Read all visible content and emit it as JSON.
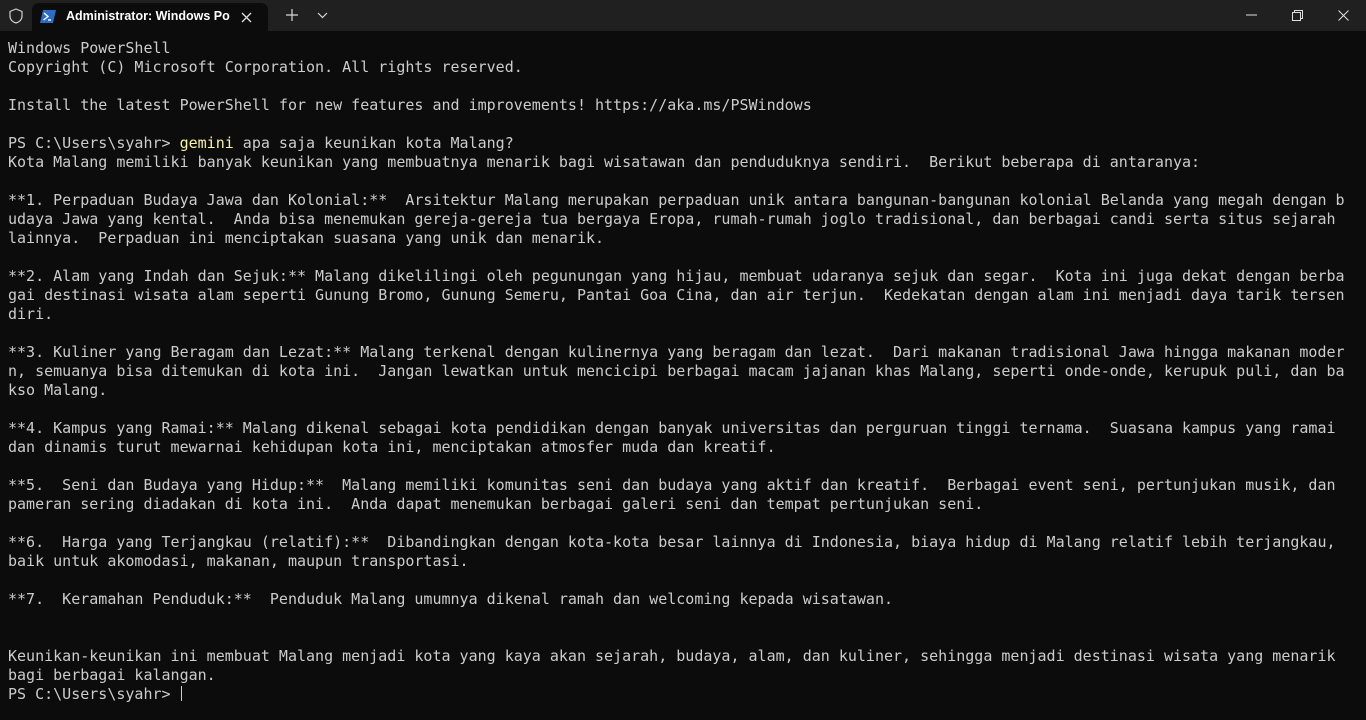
{
  "window": {
    "tab_title": "Administrator: Windows PowerShell",
    "icons": [
      "shield-icon",
      "powershell-icon",
      "close-icon",
      "plus-icon",
      "chevron-down-icon",
      "minimize-icon",
      "restore-icon",
      "window-close-icon"
    ],
    "colors": {
      "titlebar": "#202020",
      "terminal_bg": "#0c0c0c",
      "text": "#cccccc",
      "command": "#f9f1a5"
    }
  },
  "terminal": {
    "lines": [
      {
        "text": "Windows PowerShell"
      },
      {
        "text": "Copyright (C) Microsoft Corporation. All rights reserved."
      },
      {
        "text": ""
      },
      {
        "text": "Install the latest PowerShell for new features and improvements! https://aka.ms/PSWindows"
      },
      {
        "text": ""
      },
      {
        "prompt": "PS C:\\Users\\syahr> ",
        "command": "gemini",
        "args": " apa saja keunikan kota Malang?"
      },
      {
        "text": "Kota Malang memiliki banyak keunikan yang membuatnya menarik bagi wisatawan dan penduduknya sendiri.  Berikut beberapa di antaranya:"
      },
      {
        "text": ""
      },
      {
        "text": "**1. Perpaduan Budaya Jawa dan Kolonial:**  Arsitektur Malang merupakan perpaduan unik antara bangunan-bangunan kolonial Belanda yang megah dengan b"
      },
      {
        "text": "udaya Jawa yang kental.  Anda bisa menemukan gereja-gereja tua bergaya Eropa, rumah-rumah joglo tradisional, dan berbagai candi serta situs sejarah"
      },
      {
        "text": "lainnya.  Perpaduan ini menciptakan suasana yang unik dan menarik."
      },
      {
        "text": ""
      },
      {
        "text": "**2. Alam yang Indah dan Sejuk:** Malang dikelilingi oleh pegunungan yang hijau, membuat udaranya sejuk dan segar.  Kota ini juga dekat dengan berba"
      },
      {
        "text": "gai destinasi wisata alam seperti Gunung Bromo, Gunung Semeru, Pantai Goa Cina, dan air terjun.  Kedekatan dengan alam ini menjadi daya tarik tersen"
      },
      {
        "text": "diri."
      },
      {
        "text": ""
      },
      {
        "text": "**3. Kuliner yang Beragam dan Lezat:** Malang terkenal dengan kulinernya yang beragam dan lezat.  Dari makanan tradisional Jawa hingga makanan moder"
      },
      {
        "text": "n, semuanya bisa ditemukan di kota ini.  Jangan lewatkan untuk mencicipi berbagai macam jajanan khas Malang, seperti onde-onde, kerupuk puli, dan ba"
      },
      {
        "text": "kso Malang."
      },
      {
        "text": ""
      },
      {
        "text": "**4. Kampus yang Ramai:** Malang dikenal sebagai kota pendidikan dengan banyak universitas dan perguruan tinggi ternama.  Suasana kampus yang ramai"
      },
      {
        "text": "dan dinamis turut mewarnai kehidupan kota ini, menciptakan atmosfer muda dan kreatif."
      },
      {
        "text": ""
      },
      {
        "text": "**5.  Seni dan Budaya yang Hidup:**  Malang memiliki komunitas seni dan budaya yang aktif dan kreatif.  Berbagai event seni, pertunjukan musik, dan"
      },
      {
        "text": "pameran sering diadakan di kota ini.  Anda dapat menemukan berbagai galeri seni dan tempat pertunjukan seni."
      },
      {
        "text": ""
      },
      {
        "text": "**6.  Harga yang Terjangkau (relatif):**  Dibandingkan dengan kota-kota besar lainnya di Indonesia, biaya hidup di Malang relatif lebih terjangkau,"
      },
      {
        "text": "baik untuk akomodasi, makanan, maupun transportasi."
      },
      {
        "text": ""
      },
      {
        "text": "**7.  Keramahan Penduduk:**  Penduduk Malang umumnya dikenal ramah dan welcoming kepada wisatawan."
      },
      {
        "text": ""
      },
      {
        "text": ""
      },
      {
        "text": "Keunikan-keunikan ini membuat Malang menjadi kota yang kaya akan sejarah, budaya, alam, dan kuliner, sehingga menjadi destinasi wisata yang menarik"
      },
      {
        "text": "bagi berbagai kalangan."
      },
      {
        "prompt": "PS C:\\Users\\syahr> ",
        "command": "",
        "args": "",
        "cursor": true
      }
    ]
  }
}
